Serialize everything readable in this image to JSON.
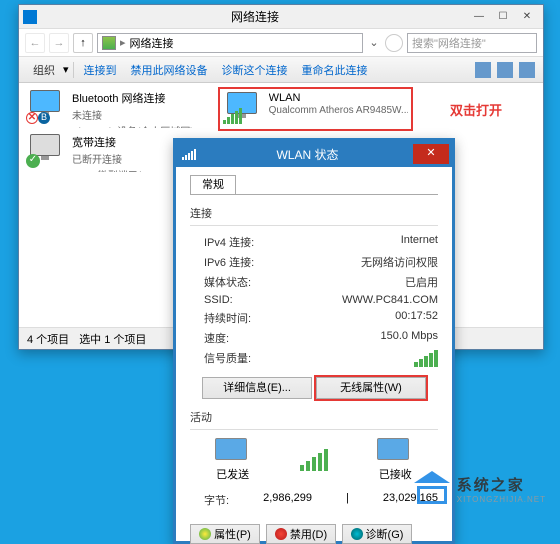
{
  "main": {
    "title": "网络连接",
    "breadcrumb": "网络连接",
    "searchPlaceholder": "搜索\"网络连接\"",
    "toolbar": {
      "org": "组织",
      "conn": "连接到",
      "disable": "禁用此网络设备",
      "diag": "诊断这个连接",
      "rename": "重命名此连接"
    },
    "conns": [
      {
        "name": "Bluetooth 网络连接",
        "sub1": "未连接",
        "sub2": "Bluetooth 设备(个人区域网)"
      },
      {
        "name": "WLAN",
        "sub1": "Qualcomm Atheros AR9485W..."
      },
      {
        "name": "宽带连接",
        "sub1": "已断开连接",
        "sub2": "WAN 微型端口(PPPOE)"
      }
    ],
    "status": {
      "count": "4 个项目",
      "sel": "选中 1 个项目"
    },
    "annot": "双击打开"
  },
  "stat": {
    "title": "WLAN 状态",
    "tab": "常规",
    "groups": {
      "conn": "连接",
      "act": "活动"
    },
    "rows": {
      "ipv4": {
        "k": "IPv4 连接:",
        "v": "Internet"
      },
      "ipv6": {
        "k": "IPv6 连接:",
        "v": "无网络访问权限"
      },
      "media": {
        "k": "媒体状态:",
        "v": "已启用"
      },
      "ssid": {
        "k": "SSID:",
        "v": "WWW.PC841.COM"
      },
      "dur": {
        "k": "持续时间:",
        "v": "00:17:52"
      },
      "speed": {
        "k": "速度:",
        "v": "150.0 Mbps"
      },
      "qual": {
        "k": "信号质量:"
      }
    },
    "btns": {
      "detail": "详细信息(E)...",
      "wprop": "无线属性(W)"
    },
    "act": {
      "sent": "已发送",
      "recv": "已接收",
      "bytes": {
        "k": "字节:",
        "s": "2,986,299",
        "r": "23,029,165"
      }
    },
    "bbtns": {
      "prop": "属性(P)",
      "dis": "禁用(D)",
      "diag": "诊断(G)"
    }
  },
  "wm": {
    "t1": "系统之家",
    "t2": "XITONGZHIJIA.NET"
  }
}
